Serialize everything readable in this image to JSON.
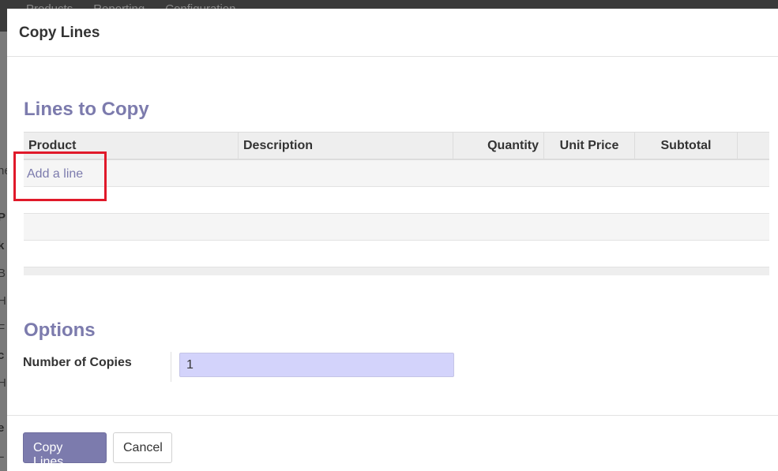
{
  "background": {
    "menu": [
      "Products",
      "Reporting",
      "Configuration"
    ],
    "side_fragments": [
      "ne",
      "P",
      "k",
      "B",
      "H",
      "F",
      "c",
      "H",
      "e",
      "L"
    ]
  },
  "modal": {
    "title": "Copy Lines",
    "lines_section_title": "Lines to Copy",
    "table": {
      "columns": [
        "Product",
        "Description",
        "Quantity",
        "Unit Price",
        "Subtotal",
        ""
      ],
      "add_line": "Add a line",
      "rows": []
    },
    "options_section_title": "Options",
    "number_of_copies": {
      "label": "Number of Copies",
      "value": "1"
    },
    "footer": {
      "primary_label": "Copy Lines",
      "secondary_label": "Cancel"
    }
  },
  "colors": {
    "accent": "#7c7bad",
    "highlight": "#e0192a",
    "input_bg": "#d3d3fb"
  }
}
